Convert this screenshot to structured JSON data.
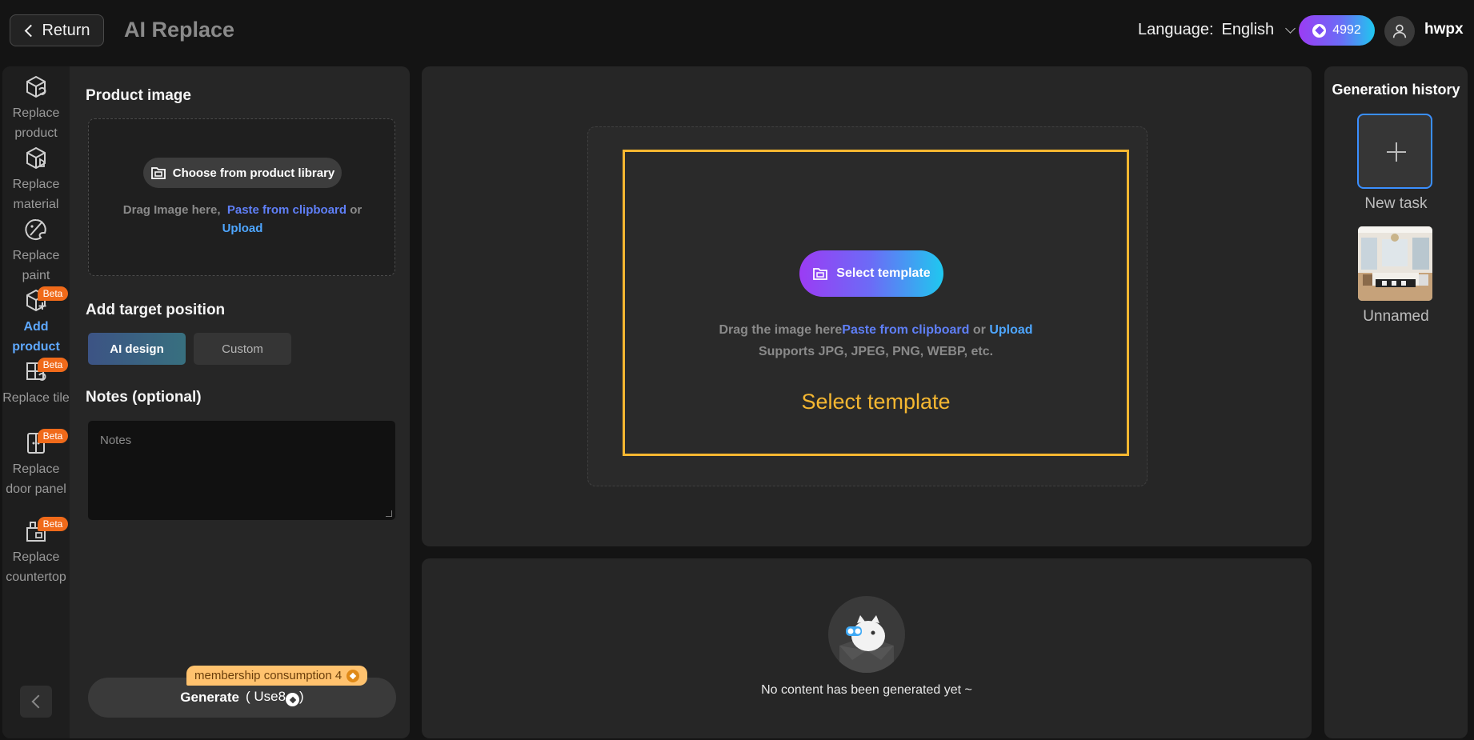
{
  "header": {
    "return_label": "Return",
    "title": "AI Replace",
    "language_label": "Language:",
    "language_value": "English",
    "credits": "4992",
    "username": "hwpx"
  },
  "tools": [
    {
      "label": "Replace product",
      "icon": "replace-product-icon",
      "beta": "",
      "active": false
    },
    {
      "label": "Replace material",
      "icon": "replace-material-icon",
      "beta": "",
      "active": false
    },
    {
      "label": "Replace paint",
      "icon": "replace-paint-icon",
      "beta": "",
      "active": false
    },
    {
      "label": "Add product",
      "icon": "add-product-icon",
      "beta": "Beta",
      "active": true
    },
    {
      "label": "Replace tile",
      "icon": "replace-tile-icon",
      "beta": "Beta",
      "active": false
    },
    {
      "label": "Replace door panel",
      "icon": "replace-door-panel-icon",
      "beta": "Beta",
      "active": false
    },
    {
      "label": "Replace countertop",
      "icon": "replace-countertop-icon",
      "beta": "Beta",
      "active": false
    }
  ],
  "form": {
    "product_image_title": "Product image",
    "library_button": "Choose from product library",
    "drag_text": "Drag Image here,",
    "paste_link": "Paste from clipboard",
    "or_text": "or",
    "upload_link": "Upload",
    "target_title": "Add target position",
    "mode_ai": "AI design",
    "mode_custom": "Custom",
    "notes_title": "Notes (optional)",
    "notes_placeholder": "Notes",
    "membership_tag": "membership consumption 4",
    "generate_label": "Generate",
    "generate_cost": "( Use8",
    "generate_close": ")"
  },
  "canvas": {
    "select_button": "Select template",
    "drag_text": "Drag the image here",
    "paste_link": "Paste from clipboard",
    "or_text": "or",
    "upload_link": "Upload",
    "formats": "Supports JPG, JPEG, PNG, WEBP, etc.",
    "frame_label": "Select template"
  },
  "result": {
    "empty_text": "No content has been generated yet ~"
  },
  "history": {
    "title": "Generation history",
    "new_task": "New task",
    "items": [
      {
        "label": "Unnamed"
      }
    ]
  },
  "colors": {
    "accent_gradient_start": "#9b3cf4",
    "accent_gradient_end": "#1fc8ef",
    "template_frame": "#f5b731",
    "beta_badge": "#f06a1a",
    "active_tool": "#5ea8ff"
  }
}
